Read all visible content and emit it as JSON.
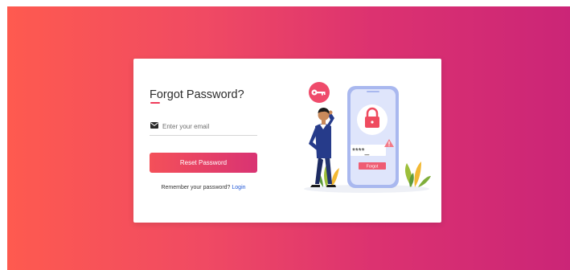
{
  "form": {
    "title": "Forgot Password?",
    "email_placeholder": "Enter your email",
    "reset_button_label": "Reset Password",
    "remember_text": "Remember your password?",
    "login_link_label": "Login"
  },
  "illustration": {
    "pin_mask": "****_",
    "phone_button_label": "Forgot",
    "icons": [
      "key-icon",
      "lock-icon",
      "warning-icon",
      "person-figure",
      "plant-leaves"
    ]
  },
  "colors": {
    "background_gradient": [
      "#fe5a4f",
      "#cb2577"
    ],
    "accent": "#ef3c5a",
    "link": "#1f57d6",
    "phone_screen": "#dfe5fb",
    "phone_frame": "#a9b8ef"
  }
}
